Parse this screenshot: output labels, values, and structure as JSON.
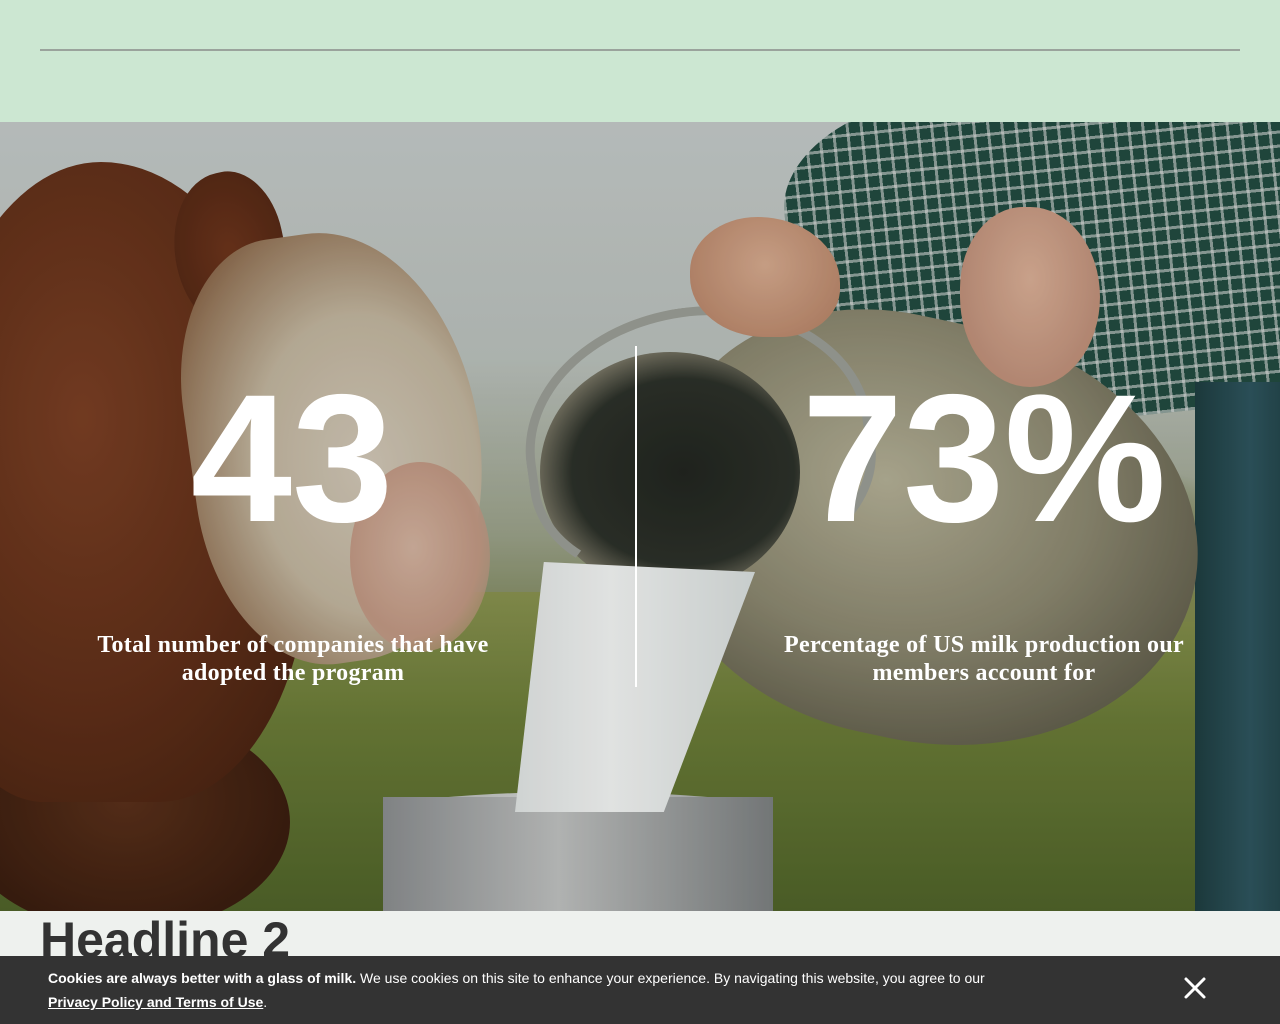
{
  "stats": [
    {
      "value": "43",
      "label": "Total number of companies that have adopted the program"
    },
    {
      "value": "73%",
      "label": "Percentage of US milk production our members account for"
    }
  ],
  "section": {
    "headline": "Headline 2"
  },
  "cookie_banner": {
    "lead": "Cookies are always better with a glass of milk.",
    "body": " We use cookies on this site to enhance your experience. By navigating this website, you agree to our",
    "link_label": "Privacy Policy and Terms of Use",
    "trailing": ".",
    "close_icon": "close-icon"
  },
  "colors": {
    "top_band": "#cce7d2",
    "cookie_bar": "#333333",
    "headline": "#333333",
    "stat_text": "#ffffff"
  }
}
